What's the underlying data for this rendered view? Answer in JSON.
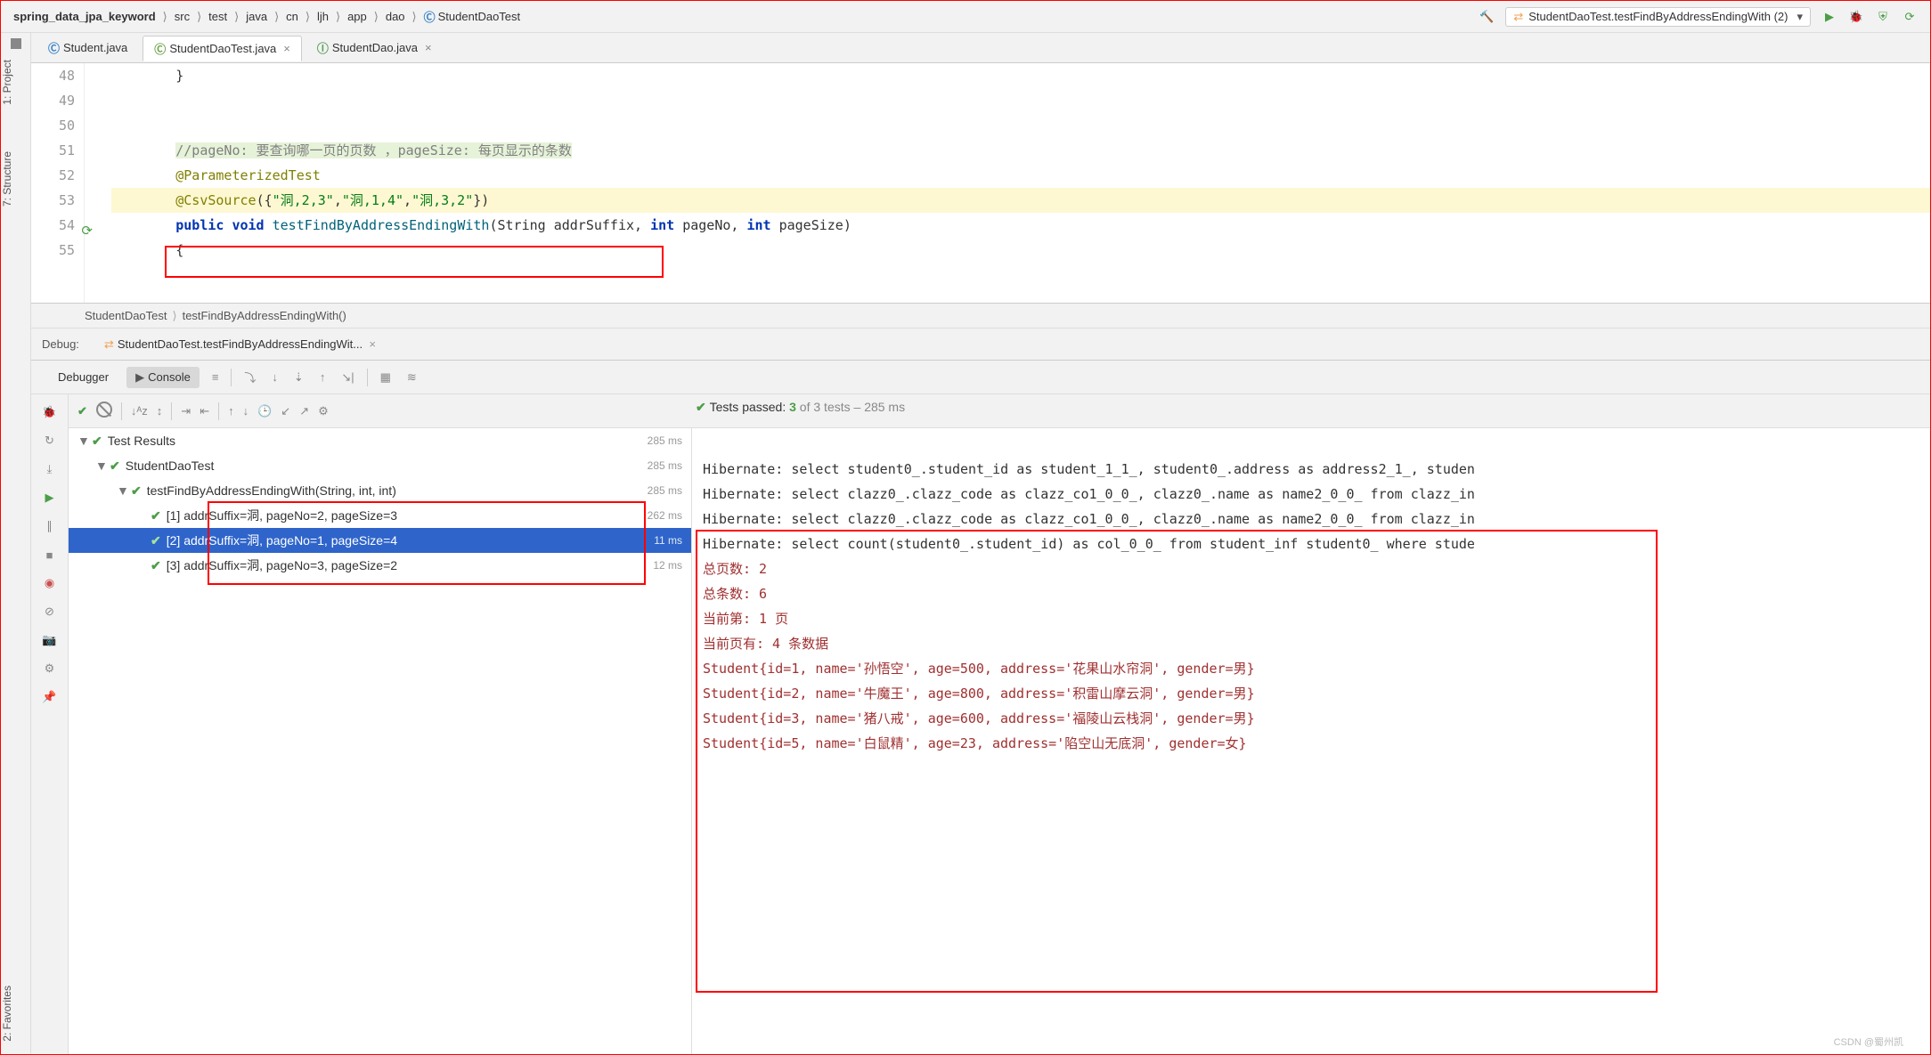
{
  "breadcrumb": {
    "root": "spring_data_jpa_keyword",
    "parts": [
      "src",
      "test",
      "java",
      "cn",
      "ljh",
      "app",
      "dao",
      "StudentDaoTest"
    ]
  },
  "run_config": {
    "label": "StudentDaoTest.testFindByAddressEndingWith (2)"
  },
  "editor_tabs": [
    {
      "label": "Student.java",
      "active": false,
      "key": "student"
    },
    {
      "label": "StudentDaoTest.java",
      "active": true,
      "key": "studentdaotest"
    },
    {
      "label": "StudentDao.java",
      "active": false,
      "key": "studentdao"
    }
  ],
  "gutter": [
    "48",
    "49",
    "50",
    "51",
    "52",
    "53",
    "54",
    "55"
  ],
  "code": {
    "l48": "        }",
    "comment": "//pageNo: 要查询哪一页的页数 ，pageSize: 每页显示的条数",
    "anno1": "@ParameterizedTest",
    "anno2": "@CsvSource",
    "anno2_args": "({\"洞,2,3\",\"洞,1,4\",\"洞,3,2\"})",
    "kw_pub": "public ",
    "kw_void": "void ",
    "fn": "testFindByAddressEndingWith",
    "params": "(String addrSuffix, ",
    "kw_int1": "int ",
    "p2": "pageNo, ",
    "kw_int2": "int ",
    "p3": "pageSize)",
    "l55": "        {"
  },
  "navigator": {
    "class": "StudentDaoTest",
    "method": "testFindByAddressEndingWith()"
  },
  "debug": {
    "label": "Debug:",
    "tab": "StudentDaoTest.testFindByAddressEndingWit...",
    "tabs": {
      "debugger": "Debugger",
      "console": "Console"
    }
  },
  "test_status": {
    "prefix": "Tests passed: ",
    "passed": "3",
    "mid": " of 3 tests – ",
    "time": "285 ms"
  },
  "tree": {
    "root": {
      "label": "Test Results",
      "ms": "285 ms"
    },
    "class": {
      "label": "StudentDaoTest",
      "ms": "285 ms"
    },
    "method": {
      "label": "testFindByAddressEndingWith(String, int, int)",
      "ms": "285 ms"
    },
    "runs": [
      {
        "label": "[1] addrSuffix=洞, pageNo=2, pageSize=3",
        "ms": "262 ms",
        "sel": false
      },
      {
        "label": "[2] addrSuffix=洞, pageNo=1, pageSize=4",
        "ms": "11 ms",
        "sel": true
      },
      {
        "label": "[3] addrSuffix=洞, pageNo=3, pageSize=2",
        "ms": "12 ms",
        "sel": false
      }
    ]
  },
  "console": {
    "h1": "Hibernate: select student0_.student_id as student_1_1_, student0_.address as address2_1_, studen",
    "h2": "Hibernate: select clazz0_.clazz_code as clazz_co1_0_0_, clazz0_.name as name2_0_0_ from clazz_in",
    "h3": "Hibernate: select clazz0_.clazz_code as clazz_co1_0_0_, clazz0_.name as name2_0_0_ from clazz_in",
    "h4": "Hibernate: select count(student0_.student_id) as col_0_0_ from student_inf student0_ where stude",
    "r1": "总页数: 2",
    "r2": "总条数: 6",
    "r3": "当前第: 1 页",
    "r4": "当前页有: 4 条数据",
    "r5": "Student{id=1, name='孙悟空', age=500, address='花果山水帘洞', gender=男}",
    "r6": "Student{id=2, name='牛魔王', age=800, address='积雷山摩云洞', gender=男}",
    "r7": "Student{id=3, name='猪八戒', age=600, address='福陵山云栈洞', gender=男}",
    "r8": "Student{id=5, name='白鼠精', age=23, address='陷空山无底洞', gender=女}"
  },
  "side": {
    "project": "1: Project",
    "structure": "7: Structure",
    "favorites": "2: Favorites"
  },
  "watermark": "CSDN @蜀州凯"
}
